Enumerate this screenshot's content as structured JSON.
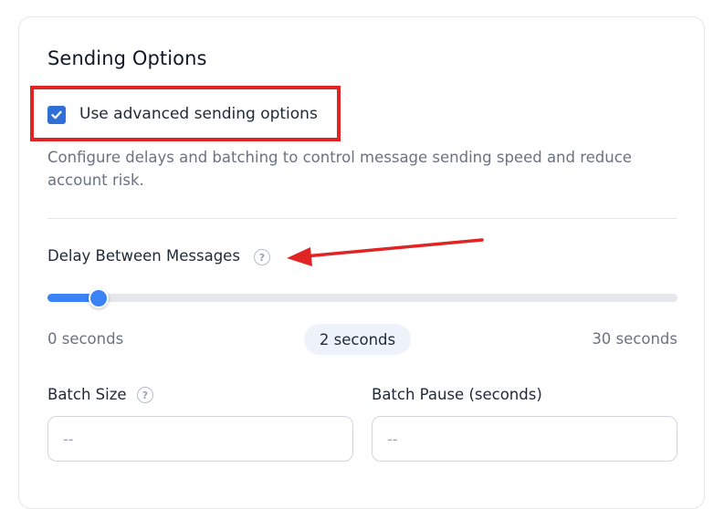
{
  "section": {
    "title": "Sending Options"
  },
  "advanced": {
    "checkbox_label": "Use advanced sending options",
    "checked": true,
    "description": "Configure delays and batching to control message sending speed and reduce account risk."
  },
  "delay": {
    "label": "Delay Between Messages",
    "help_glyph": "?",
    "min_label": "0 seconds",
    "max_label": "30 seconds",
    "value_label": "2 seconds",
    "min": 0,
    "max": 30,
    "value": 2
  },
  "batch_size": {
    "label": "Batch Size",
    "help_glyph": "?",
    "placeholder": "--",
    "value": ""
  },
  "batch_pause": {
    "label": "Batch Pause (seconds)",
    "placeholder": "--",
    "value": ""
  },
  "colors": {
    "accent": "#3b82f6",
    "checkbox": "#2f6fd6",
    "annotation": "#e02424"
  },
  "icons": {
    "checkbox_mark": "checkmark-icon",
    "help": "question-mark-icon",
    "annotation": "arrow-icon"
  }
}
